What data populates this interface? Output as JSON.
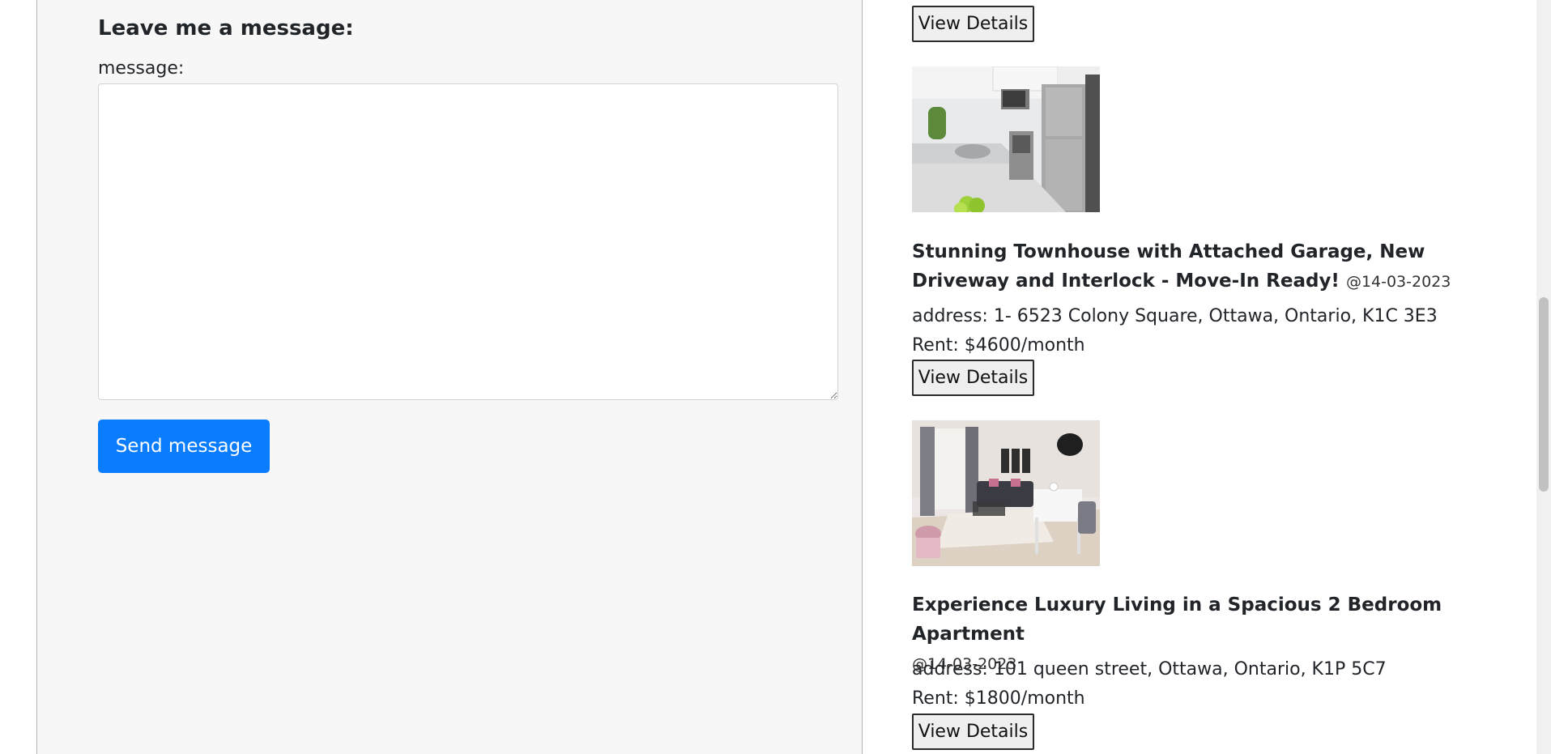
{
  "message_form": {
    "heading": "Leave me a message:",
    "label": "message:",
    "textarea_value": "",
    "send_label": "Send message"
  },
  "listings": {
    "view_details_label": "View Details",
    "items": [
      {
        "title": "Stunning Townhouse with Attached Garage, New Driveway and Interlock - Move-In Ready!",
        "date": "@14-03-2023",
        "address": "address: 1- 6523 Colony Square, Ottawa, Ontario, K1C 3E3",
        "rent": "Rent: $4600/month"
      },
      {
        "title": "Experience Luxury Living in a Spacious 2 Bedroom Apartment",
        "date": "@14-03-2023",
        "address": "address: 101 queen street, Ottawa, Ontario, K1P 5C7",
        "rent": "Rent: $1800/month"
      }
    ]
  },
  "colors": {
    "panel_bg": "#f7f7f7",
    "primary_button": "#0a7cfe"
  }
}
